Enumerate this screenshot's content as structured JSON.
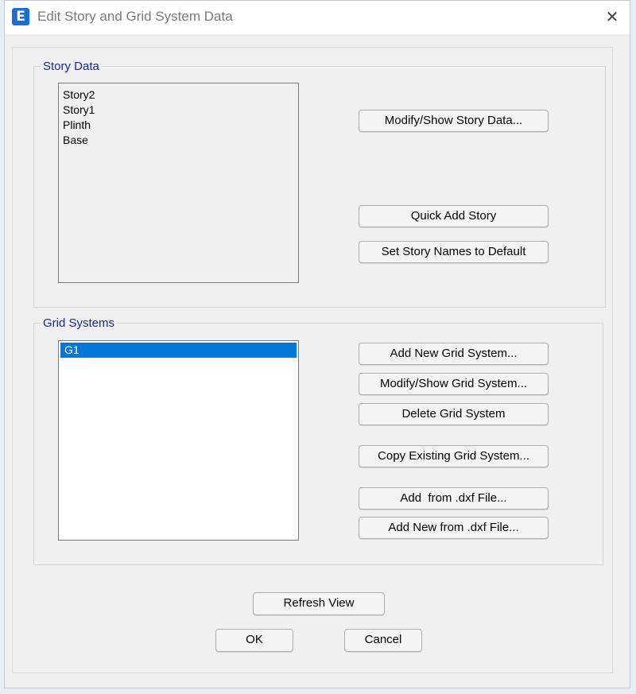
{
  "window": {
    "title": "Edit Story and Grid System Data",
    "app_icon_letter": "E",
    "close_symbol": "✕"
  },
  "story_data": {
    "legend": "Story Data",
    "stories": [
      "Story2",
      "Story1",
      "Plinth",
      "Base"
    ],
    "buttons": {
      "modify_show": "Modify/Show Story Data...",
      "quick_add": "Quick Add Story",
      "set_default": "Set Story Names to Default"
    }
  },
  "grid_systems": {
    "legend": "Grid Systems",
    "items": [
      "G1"
    ],
    "selected": "G1",
    "buttons": {
      "add_new": "Add New Grid System...",
      "modify_show": "Modify/Show Grid System...",
      "delete": "Delete Grid System",
      "copy_existing": "Copy Existing Grid System...",
      "add_from_dxf": "Add  from .dxf File...",
      "add_new_from_dxf": "Add New from .dxf File..."
    }
  },
  "footer": {
    "refresh": "Refresh View",
    "ok": "OK",
    "cancel": "Cancel"
  },
  "colors": {
    "accent": "#0078d7",
    "legend_text": "#1a2a8a",
    "app_icon": "#1a6fd1"
  }
}
